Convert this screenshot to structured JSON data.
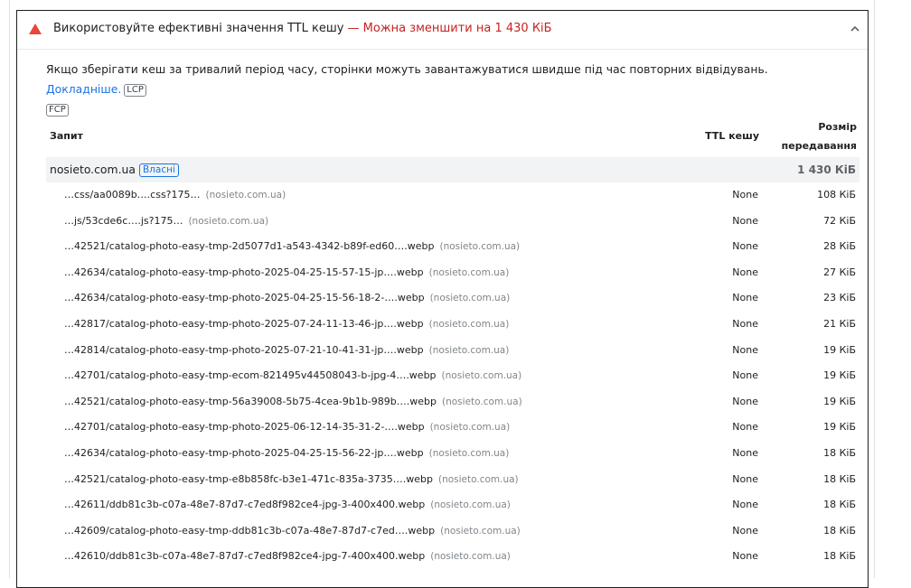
{
  "audit": {
    "title": "Використовуйте ефективні значення TTL кешу",
    "savings": " — Можна зменшити на 1 430 КіБ",
    "description": "Якщо зберігати кеш за тривалий період часу, сторінки можуть завантажуватися швидше під час повторних відвідувань.",
    "learn_more": "Докладніше.",
    "metrics": [
      "LCP",
      "FCP"
    ],
    "colors": {
      "fail": "#c5221f",
      "link": "#1a73e8"
    }
  },
  "table": {
    "headers": {
      "url": "Запит",
      "ttl": "TTL кешу",
      "size_line1": "Розмір",
      "size_line2": "передавання"
    },
    "group": {
      "name": "nosieto.com.ua",
      "badge": "Власні",
      "total": "1 430 КіБ"
    },
    "rows": [
      {
        "url": "…css/aa0089b….css?175…",
        "origin": "(nosieto.com.ua)",
        "ttl": "None",
        "size": "108 КіБ"
      },
      {
        "url": "…js/53cde6c….js?175…",
        "origin": "(nosieto.com.ua)",
        "ttl": "None",
        "size": "72 КіБ"
      },
      {
        "url": "…42521/catalog-photo-easy-tmp-2d5077d1-a543-4342-b89f-ed60….webp",
        "origin": "(nosieto.com.ua)",
        "ttl": "None",
        "size": "28 КіБ"
      },
      {
        "url": "…42634/catalog-photo-easy-tmp-photo-2025-04-25-15-57-15-jp….webp",
        "origin": "(nosieto.com.ua)",
        "ttl": "None",
        "size": "27 КіБ"
      },
      {
        "url": "…42634/catalog-photo-easy-tmp-photo-2025-04-25-15-56-18-2-….webp",
        "origin": "(nosieto.com.ua)",
        "ttl": "None",
        "size": "23 КіБ"
      },
      {
        "url": "…42817/catalog-photo-easy-tmp-photo-2025-07-24-11-13-46-jp….webp",
        "origin": "(nosieto.com.ua)",
        "ttl": "None",
        "size": "21 КіБ"
      },
      {
        "url": "…42814/catalog-photo-easy-tmp-photo-2025-07-21-10-41-31-jp….webp",
        "origin": "(nosieto.com.ua)",
        "ttl": "None",
        "size": "19 КіБ"
      },
      {
        "url": "…42701/catalog-photo-easy-tmp-ecom-821495v44508043-b-jpg-4….webp",
        "origin": "(nosieto.com.ua)",
        "ttl": "None",
        "size": "19 КіБ"
      },
      {
        "url": "…42521/catalog-photo-easy-tmp-56a39008-5b75-4cea-9b1b-989b….webp",
        "origin": "(nosieto.com.ua)",
        "ttl": "None",
        "size": "19 КіБ"
      },
      {
        "url": "…42701/catalog-photo-easy-tmp-photo-2025-06-12-14-35-31-2-….webp",
        "origin": "(nosieto.com.ua)",
        "ttl": "None",
        "size": "19 КіБ"
      },
      {
        "url": "…42634/catalog-photo-easy-tmp-photo-2025-04-25-15-56-22-jp….webp",
        "origin": "(nosieto.com.ua)",
        "ttl": "None",
        "size": "18 КіБ"
      },
      {
        "url": "…42521/catalog-photo-easy-tmp-e8b858fc-b3e1-471c-835a-3735….webp",
        "origin": "(nosieto.com.ua)",
        "ttl": "None",
        "size": "18 КіБ"
      },
      {
        "url": "…42611/ddb81c3b-c07a-48e7-87d7-c7ed8f982ce4-jpg-3-400x400.webp",
        "origin": "(nosieto.com.ua)",
        "ttl": "None",
        "size": "18 КіБ"
      },
      {
        "url": "…42609/catalog-photo-easy-tmp-ddb81c3b-c07a-48e7-87d7-c7ed….webp",
        "origin": "(nosieto.com.ua)",
        "ttl": "None",
        "size": "18 КіБ"
      },
      {
        "url": "…42610/ddb81c3b-c07a-48e7-87d7-c7ed8f982ce4-jpg-7-400x400.webp",
        "origin": "(nosieto.com.ua)",
        "ttl": "None",
        "size": "18 КіБ"
      }
    ]
  }
}
